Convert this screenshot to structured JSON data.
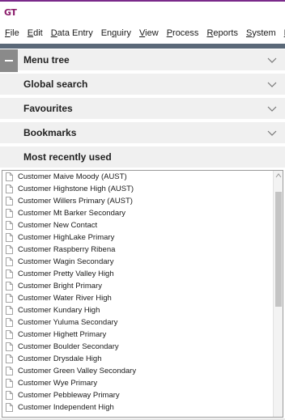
{
  "app": {
    "logo_text": "GT",
    "accent_color": "#8a1c6a",
    "menubar_rule_color": "#5a6878"
  },
  "menubar": {
    "items": [
      {
        "accel": "F",
        "rest": "ile"
      },
      {
        "accel": "E",
        "rest": "dit"
      },
      {
        "accel": "D",
        "rest": "ata Entry"
      },
      {
        "pre": "En",
        "accel": "q",
        "rest": "uiry"
      },
      {
        "accel": "V",
        "rest": "iew"
      },
      {
        "accel": "P",
        "rest": "rocess"
      },
      {
        "accel": "R",
        "rest": "eports"
      },
      {
        "accel": "S",
        "rest": "ystem"
      },
      {
        "accel": "H",
        "rest": "R"
      }
    ]
  },
  "accordion": {
    "sections": [
      {
        "label": "Menu tree",
        "icon": "chevron-down-icon",
        "collapse_icon": "minus-icon"
      },
      {
        "label": "Global search",
        "icon": "chevron-down-icon"
      },
      {
        "label": "Favourites",
        "icon": "chevron-down-icon"
      },
      {
        "label": "Bookmarks",
        "icon": "chevron-down-icon"
      },
      {
        "label": "Most recently used"
      }
    ]
  },
  "mru_list": {
    "item_icon": "document-icon",
    "items": [
      "Customer Maive Moody (AUST)",
      "Customer Highstone High (AUST)",
      "Customer Willers Primary (AUST)",
      "Customer Mt Barker Secondary",
      "Customer New Contact",
      "Customer HighLake Primary",
      "Customer Raspberry Ribena",
      "Customer Wagin Secondary",
      "Customer Pretty Valley High",
      "Customer Bright Primary",
      "Customer Water River High",
      "Customer Kundary High",
      "Customer Yuluma Secondary",
      "Customer Highett Primary",
      "Customer Boulder Secondary",
      "Customer Drysdale High",
      "Customer Green Valley Secondary",
      "Customer Wye Primary",
      "Customer Pebbleway Primary",
      "Customer Independent High"
    ]
  }
}
